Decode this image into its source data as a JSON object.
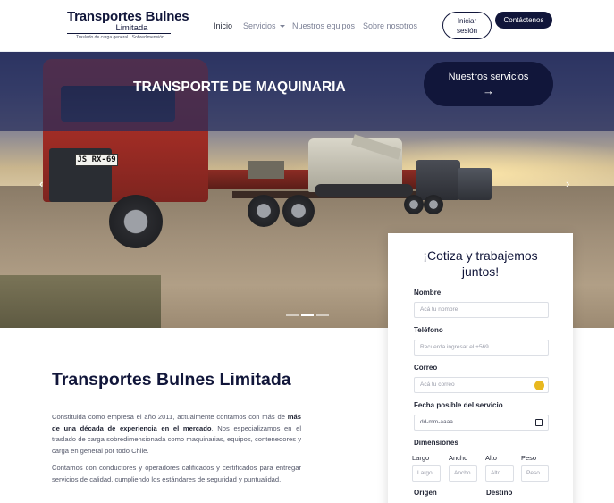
{
  "navbar": {
    "logo_title": "Transportes Bulnes",
    "logo_subtitle": "Limitada",
    "logo_tagline": "Traslado de carga general · Sobredimensión",
    "links": [
      "Inicio",
      "Servicios",
      "Nuestros equipos",
      "Sobre nosotros"
    ],
    "login_label_1": "Iniciar",
    "login_label_2": "sesión",
    "contact_label": "Contáctenos"
  },
  "hero": {
    "title": "TRANSPORTE DE MAQUINARIA",
    "services_button": "Nuestros servicios",
    "services_arrow": "→",
    "prev_icon": "‹",
    "next_icon": "›",
    "plate": "JS RX-69",
    "slides_count": 3,
    "active_slide": 2
  },
  "about": {
    "title": "Transportes Bulnes Limitada",
    "p1_start": "Constituida como empresa el año 2011, actualmente contamos con más de ",
    "p1_bold": "más de una década de experiencia en el mercado",
    "p1_end": ". Nos especializamos en el traslado de carga sobredimensionada como maquinarias, equipos, contenedores y carga en general por todo Chile.",
    "p2": "Contamos con conductores y operadores calificados y certificados para entregar servicios de calidad, cumpliendo los estándares de seguridad y puntualidad."
  },
  "quote_form": {
    "title_line1": "¡Cotiza y trabajemos",
    "title_line2": "juntos!",
    "name_label": "Nombre",
    "name_placeholder": "Acá tu nombre",
    "phone_label": "Teléfono",
    "phone_placeholder": "Recuerda ingresar el +569",
    "email_label": "Correo",
    "email_placeholder": "Acá tu correo",
    "date_label": "Fecha posible del servicio",
    "date_placeholder": "dd-mm-aaaa",
    "dimensions_label": "Dimensiones",
    "dim_fields": [
      {
        "label": "Largo",
        "placeholder": "Largo"
      },
      {
        "label": "Ancho",
        "placeholder": "Ancho"
      },
      {
        "label": "Alto",
        "placeholder": "Alto"
      },
      {
        "label": "Peso",
        "placeholder": "Peso"
      }
    ],
    "origin_label": "Origen",
    "destination_label": "Destino"
  },
  "colors": {
    "primary": "#11163a",
    "text": "#1f2333",
    "muted": "#55596b",
    "hero_overlay": "#262d5c"
  }
}
